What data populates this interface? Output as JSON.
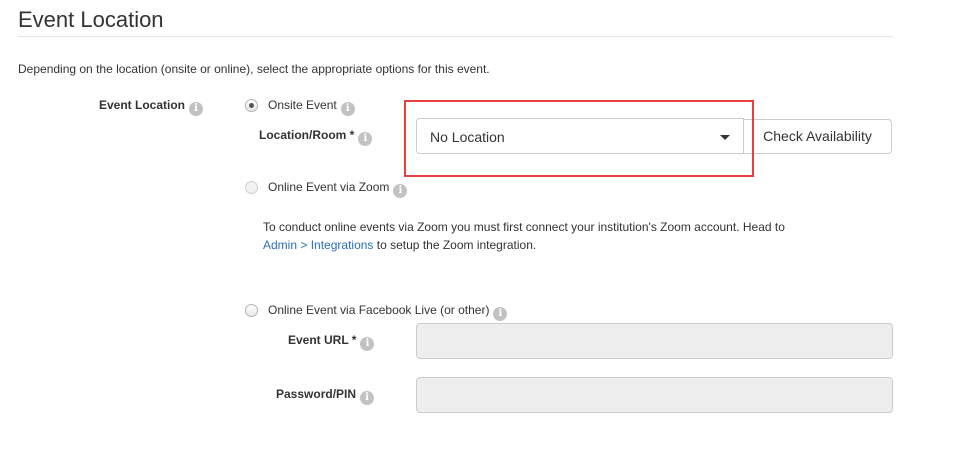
{
  "section": {
    "title": "Event Location",
    "description": "Depending on the location (onsite or online), select the appropriate options for this event."
  },
  "event_location": {
    "label": "Event Location",
    "onsite": {
      "label": "Onsite Event",
      "selected": true,
      "room_label": "Location/Room *",
      "room_value": "No Location",
      "check_button": "Check Availability"
    },
    "zoom": {
      "label": "Online Event via Zoom",
      "disabled": true,
      "note_text": "To conduct online events via Zoom you must first connect your institution's Zoom account. Head to",
      "link_admin": "Admin",
      "link_sep": ">",
      "link_integrations": "Integrations",
      "note_suffix": "to setup the Zoom integration."
    },
    "facebook": {
      "label": "Online Event via Facebook Live (or other)",
      "url_label": "Event URL *",
      "url_value": "",
      "password_label": "Password/PIN",
      "password_value": ""
    }
  },
  "icons": {
    "info": "info-icon",
    "dropdown": "caret-down-icon"
  },
  "colors": {
    "highlight": "#e8403f",
    "link": "#2a6ebb",
    "disabled_input": "#eeeeee"
  }
}
